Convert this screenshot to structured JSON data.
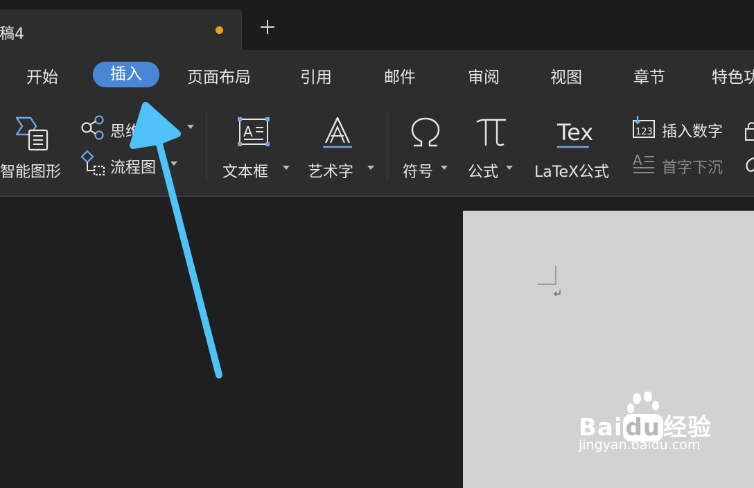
{
  "tabbar": {
    "doc_title": "稿4",
    "new_tab": "+"
  },
  "menu": {
    "items": [
      "开始",
      "插入",
      "页面布局",
      "引用",
      "邮件",
      "审阅",
      "视图",
      "章节",
      "特色功能"
    ],
    "active": "插入"
  },
  "ribbon": {
    "smart_graphic": "智能图形",
    "mind_map": "思维导图",
    "flowchart": "流程图",
    "text_box": "文本框",
    "word_art": "艺术字",
    "symbol": "符号",
    "formula": "公式",
    "latex": "LaTeX公式",
    "insert_number": "插入数字",
    "drop_cap": "首字下沉",
    "tex_icon_text": "Tex",
    "number_icon_text": "123"
  },
  "watermark": {
    "brand_a": "Bai",
    "brand_b": "du",
    "brand_c": "经验",
    "url": "jingyan.baidu.com"
  },
  "colors": {
    "accent": "#4a86d4",
    "arrow": "#4fc3f7",
    "unsaved": "#f0a020"
  }
}
